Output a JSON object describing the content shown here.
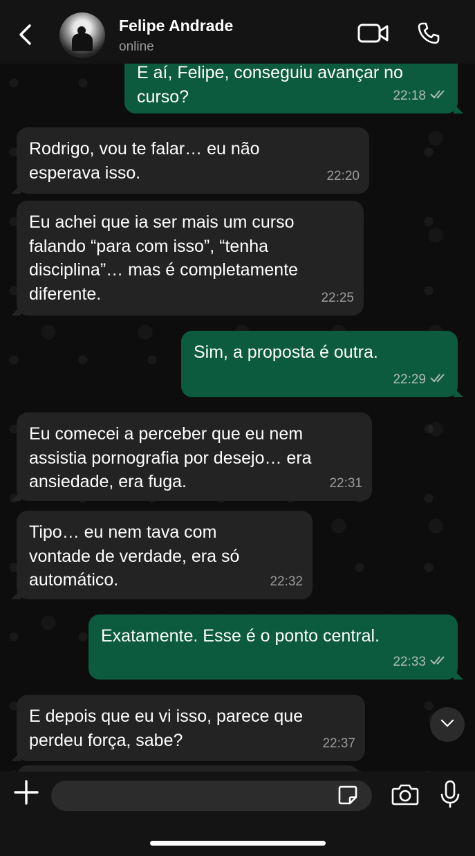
{
  "header": {
    "contact_name": "Felipe Andrade",
    "status": "online",
    "icons": {
      "back": "chevron-left-icon",
      "video": "video-camera-icon",
      "call": "phone-icon"
    }
  },
  "messages": [
    {
      "direction": "out",
      "text": "E aí, Felipe, conseguiu avançar no curso?",
      "time": "22:18",
      "read": true
    },
    {
      "direction": "in",
      "text": "Rodrigo, vou te falar… eu não esperava isso.",
      "time": "22:20"
    },
    {
      "direction": "in",
      "text": "Eu achei que ia ser mais um curso falando “para com isso”, “tenha disciplina”… mas é completamente diferente.",
      "time": "22:25"
    },
    {
      "direction": "out",
      "text": "Sim, a proposta é outra.",
      "time": "22:29",
      "read": true
    },
    {
      "direction": "in",
      "text": "Eu comecei a perceber que eu nem assistia pornografia por desejo… era ansiedade, era fuga.",
      "time": "22:31"
    },
    {
      "direction": "in",
      "text": "Tipo… eu nem tava com vontade de verdade, era só automático.",
      "time": "22:32"
    },
    {
      "direction": "out",
      "text": "Exatamente. Esse é o ponto central.",
      "time": "22:33",
      "read": true
    },
    {
      "direction": "in",
      "text": "E depois que eu vi isso, parece que perdeu força, sabe?",
      "time": "22:37"
    }
  ],
  "input": {
    "placeholder": "",
    "value": ""
  },
  "colors": {
    "incoming_bubble": "#232323",
    "outgoing_bubble": "#0c5b3e",
    "read_ticks": "#aebdb5"
  }
}
